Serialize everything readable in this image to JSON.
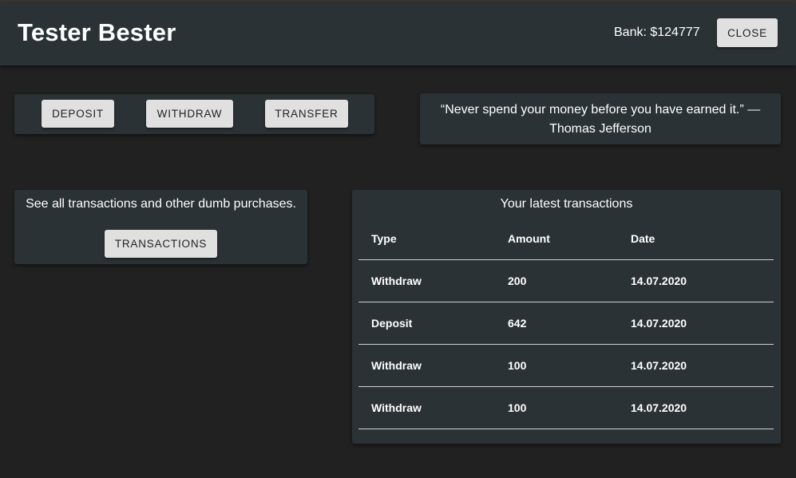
{
  "header": {
    "title": "Tester Bester",
    "bank": "Bank: $124777",
    "close_label": "CLOSE"
  },
  "actions": {
    "deposit_label": "DEPOSIT",
    "withdraw_label": "WITHDRAW",
    "transfer_label": "TRANSFER"
  },
  "quote": {
    "text": "“Never spend your money before you have earned it.” — Thomas Jefferson"
  },
  "transactions_card": {
    "description": "See all transactions and other dumb purchases.",
    "button_label": "TRANSACTIONS"
  },
  "latest": {
    "title": "Your latest transactions",
    "columns": [
      "Type",
      "Amount",
      "Date"
    ],
    "rows": [
      {
        "type": "Withdraw",
        "amount": "200",
        "date": "14.07.2020"
      },
      {
        "type": "Deposit",
        "amount": "642",
        "date": "14.07.2020"
      },
      {
        "type": "Withdraw",
        "amount": "100",
        "date": "14.07.2020"
      },
      {
        "type": "Withdraw",
        "amount": "100",
        "date": "14.07.2020"
      }
    ]
  },
  "colors": {
    "background": "#212121",
    "panel": "#2b3235",
    "button": "#e0e0e0"
  }
}
